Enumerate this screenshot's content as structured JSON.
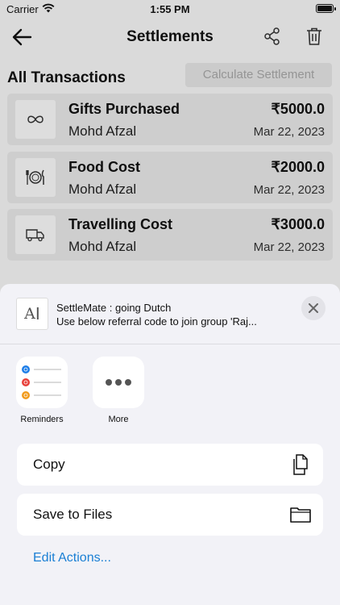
{
  "status": {
    "carrier": "Carrier",
    "time": "1:55 PM"
  },
  "nav": {
    "title": "Settlements",
    "back_icon": "back-arrow-icon",
    "share_icon": "share-icon",
    "delete_icon": "trash-icon"
  },
  "section": {
    "title": "All Transactions",
    "calculate_label": "Calculate Settlement"
  },
  "transactions": [
    {
      "title": "Gifts Purchased",
      "member": "Mohd Afzal",
      "amount": "₹5000.0",
      "date": "Mar 22, 2023",
      "icon": "infinity-icon"
    },
    {
      "title": "Food Cost",
      "member": "Mohd Afzal",
      "amount": "₹2000.0",
      "date": "Mar 22, 2023",
      "icon": "plate-cutlery-icon"
    },
    {
      "title": "Travelling Cost",
      "member": "Mohd Afzal",
      "amount": "₹3000.0",
      "date": "Mar 22, 2023",
      "icon": "truck-icon"
    }
  ],
  "share_sheet": {
    "preview_title": "SettleMate : going Dutch",
    "preview_text": "Use below referral code to join group 'Raj...",
    "apps": [
      {
        "label": "Reminders",
        "icon": "reminders-icon"
      },
      {
        "label": "More",
        "icon": "more-icon"
      }
    ],
    "actions": [
      {
        "label": "Copy",
        "icon": "copy-icon"
      },
      {
        "label": "Save to Files",
        "icon": "folder-icon"
      }
    ],
    "edit_actions": "Edit Actions..."
  },
  "colors": {
    "link": "#1a7fd4",
    "sheet_bg": "#f2f2f7",
    "card_bg": "#e6e6e6"
  }
}
